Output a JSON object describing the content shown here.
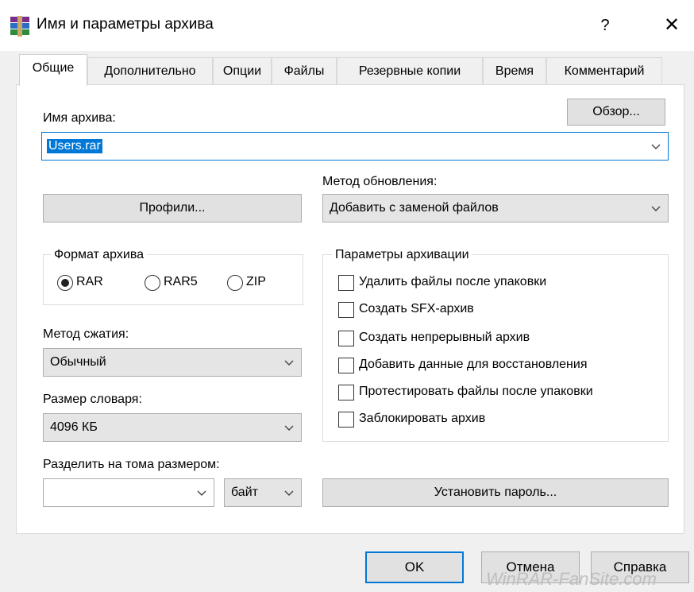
{
  "window": {
    "title": "Имя и параметры архива",
    "help_glyph": "?",
    "close_glyph": "✕",
    "icon": "winrar-books-icon"
  },
  "tabs": [
    {
      "label": "Общие",
      "active": true
    },
    {
      "label": "Дополнительно"
    },
    {
      "label": "Опции"
    },
    {
      "label": "Файлы"
    },
    {
      "label": "Резервные копии"
    },
    {
      "label": "Время"
    },
    {
      "label": "Комментарий"
    }
  ],
  "general": {
    "archive_name_label": "Имя архива:",
    "archive_name_value": "Users.rar",
    "browse_label": "Обзор...",
    "profiles_label": "Профили...",
    "update_method_label": "Метод обновления:",
    "update_method_value": "Добавить с заменой файлов",
    "format": {
      "title": "Формат архива",
      "options": [
        {
          "label": "RAR",
          "checked": true
        },
        {
          "label": "RAR5",
          "checked": false
        },
        {
          "label": "ZIP",
          "checked": false
        }
      ]
    },
    "compression_label": "Метод сжатия:",
    "compression_value": "Обычный",
    "dictionary_label": "Размер словаря:",
    "dictionary_value": "4096 КБ",
    "split_label": "Разделить на тома размером:",
    "split_value": "",
    "split_unit": "байт",
    "archiving_options": {
      "title": "Параметры архивации",
      "items": [
        {
          "label": "Удалить файлы после упаковки",
          "checked": false
        },
        {
          "label": "Создать SFX-архив",
          "checked": false
        },
        {
          "label": "Создать непрерывный архив",
          "checked": false
        },
        {
          "label": "Добавить данные для восстановления",
          "checked": false
        },
        {
          "label": "Протестировать файлы после упаковки",
          "checked": false
        },
        {
          "label": "Заблокировать архив",
          "checked": false
        }
      ]
    },
    "set_password_label": "Установить пароль..."
  },
  "footer": {
    "ok_label": "OK",
    "cancel_label": "Отмена",
    "help_label": "Справка"
  },
  "watermark": "WinRAR-FanSite.com",
  "colors": {
    "accent": "#0078d7",
    "selection": "#0078d7"
  }
}
